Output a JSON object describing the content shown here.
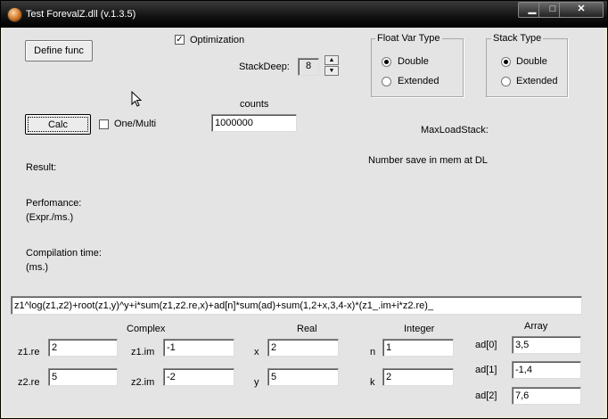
{
  "window": {
    "title": "Test ForevalZ.dll  (v.1.3.5)",
    "minimize": "▁",
    "maximize": "□",
    "close": "✕"
  },
  "buttons": {
    "define_func": "Define func",
    "calc": "Calc"
  },
  "options": {
    "optimization_label": "Optimization",
    "optimization_mark": "✓",
    "stack_deep_label": "StackDeep:",
    "stack_deep_value": "8",
    "spin_up": "▲",
    "spin_down": "▼",
    "one_multi_label": "One/Multi",
    "counts_label": "counts",
    "counts_value": "1000000"
  },
  "float_var_type": {
    "title": "Float Var Type",
    "double": "Double",
    "extended": "Extended"
  },
  "stack_type": {
    "title": "Stack Type",
    "double": "Double",
    "extended": "Extended"
  },
  "info": {
    "max_load_stack": "MaxLoadStack:",
    "number_save": "Number save in mem at DL",
    "result": "Result:",
    "performance_1": "Perfomance:",
    "performance_2": "(Expr./ms.)",
    "compilation_1": "Compilation time:",
    "compilation_2": "(ms.)"
  },
  "expression": "z1^log(z1,z2)+root(z1,y)^y+i*sum(z1,z2.re,x)+ad[n]*sum(ad)+sum(1,2+x,3,4-x)*(z1_.im+i*z2.re)_",
  "sections": {
    "complex": "Complex",
    "real": "Real",
    "integer": "Integer",
    "array": "Array"
  },
  "vars": {
    "z1_re": {
      "label": "z1.re",
      "value": "2"
    },
    "z2_re": {
      "label": "z2.re",
      "value": "5"
    },
    "z1_im": {
      "label": "z1.im",
      "value": "-1"
    },
    "z2_im": {
      "label": "z2.im",
      "value": "-2"
    },
    "x": {
      "label": "x",
      "value": "2"
    },
    "y": {
      "label": "y",
      "value": "5"
    },
    "n": {
      "label": "n",
      "value": "1"
    },
    "k": {
      "label": "k",
      "value": "2"
    },
    "ad0": {
      "label": "ad[0]",
      "value": "3,5"
    },
    "ad1": {
      "label": "ad[1]",
      "value": "-1,4"
    },
    "ad2": {
      "label": "ad[2]",
      "value": "7,6"
    }
  }
}
